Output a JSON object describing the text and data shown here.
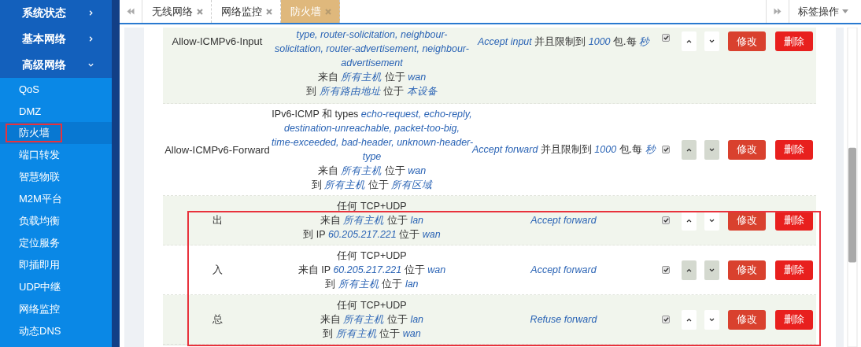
{
  "sidebar": {
    "groups": [
      {
        "label": "系统状态",
        "expanded": false
      },
      {
        "label": "基本网络",
        "expanded": false
      },
      {
        "label": "高级网络",
        "expanded": true,
        "items": [
          {
            "label": "QoS",
            "selected": false,
            "highlighted": false
          },
          {
            "label": "DMZ",
            "selected": false,
            "highlighted": false
          },
          {
            "label": "防火墙",
            "selected": true,
            "highlighted": true
          },
          {
            "label": "端口转发",
            "selected": false,
            "highlighted": false
          },
          {
            "label": "智慧物联",
            "selected": false,
            "highlighted": false
          },
          {
            "label": "M2M平台",
            "selected": false,
            "highlighted": false
          },
          {
            "label": "负载均衡",
            "selected": false,
            "highlighted": false
          },
          {
            "label": "定位服务",
            "selected": false,
            "highlighted": false
          },
          {
            "label": "即插即用",
            "selected": false,
            "highlighted": false
          },
          {
            "label": "UDP中继",
            "selected": false,
            "highlighted": false
          },
          {
            "label": "网络监控",
            "selected": false,
            "highlighted": false
          },
          {
            "label": "动态DNS",
            "selected": false,
            "highlighted": false
          }
        ]
      }
    ]
  },
  "tabs": {
    "items": [
      {
        "label": "无线网络",
        "selected": false
      },
      {
        "label": "网络监控",
        "selected": false
      },
      {
        "label": "防火墙",
        "selected": true
      }
    ],
    "menu_label": "标签操作"
  },
  "rules": [
    {
      "name": "Allow-ICMPv6-Input",
      "match_lines": [
        "*type, router-solicitation, neighbour-*",
        "*solicitation, router-advertisement, neighbour-*",
        "*advertisement*",
        "来自 *所有主机* 位于 *wan*",
        "到 *所有路由地址* 位于 *本设备*"
      ],
      "action": "*Accept input* 并且限制到 *1000* 包.每 *秒*",
      "enabled": true,
      "highlighted": false,
      "edit_label": "修改",
      "delete_label": "删除"
    },
    {
      "name": "Allow-ICMPv6-Forward",
      "match_lines": [
        "IPv6-ICMP 和 types *echo-request, echo-reply,*",
        "*destination-unreachable, packet-too-big,*",
        "*time-exceeded, bad-header, unknown-header-*",
        "*type*",
        "来自 *所有主机* 位于 *wan*",
        "到 *所有主机* 位于 *所有区域*"
      ],
      "action": "*Accept forward* 并且限制到 *1000* 包.每 *秒*",
      "enabled": true,
      "highlighted": false,
      "edit_label": "修改",
      "delete_label": "删除"
    },
    {
      "name": "出",
      "match_lines": [
        "任何 TCP+UDP",
        "来自 *所有主机* 位于 *lan*",
        "到 IP *60.205.217.221* 位于 *wan*"
      ],
      "action": "*Accept forward*",
      "enabled": true,
      "highlighted": true,
      "edit_label": "修改",
      "delete_label": "删除"
    },
    {
      "name": "入",
      "match_lines": [
        "任何 TCP+UDP",
        "来自 IP *60.205.217.221* 位于 *wan*",
        "到 *所有主机* 位于 *lan*"
      ],
      "action": "*Accept forward*",
      "enabled": true,
      "highlighted": true,
      "edit_label": "修改",
      "delete_label": "删除"
    },
    {
      "name": "总",
      "match_lines": [
        "任何 TCP+UDP",
        "来自 *所有主机* 位于 *lan*",
        "到 *所有主机* 位于 *wan*"
      ],
      "action": "*Refuse forward*",
      "enabled": true,
      "highlighted": true,
      "edit_label": "修改",
      "delete_label": "删除"
    }
  ]
}
